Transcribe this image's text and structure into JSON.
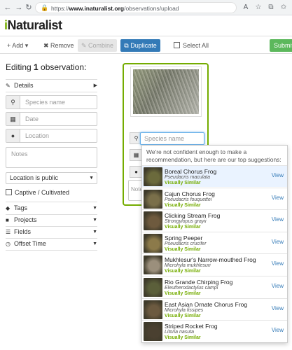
{
  "browser": {
    "url_domain": "www.inaturalist.org",
    "url_path": "/observations/upload",
    "url_prefix": "https://"
  },
  "logo": {
    "first": "i",
    "rest": "Naturalist"
  },
  "toolbar": {
    "add_label": "Add",
    "remove_label": "Remove",
    "combine_label": "Combine",
    "duplicate_label": "Duplicate",
    "select_all_label": "Select All",
    "submit_label": "Submit"
  },
  "panel": {
    "heading_prefix": "Editing ",
    "heading_count": "1",
    "heading_suffix": " observation:",
    "details_label": "Details",
    "species_placeholder": "Species name",
    "date_placeholder": "Date",
    "location_placeholder": "Location",
    "notes_placeholder": "Notes",
    "location_visibility": "Location is public",
    "captive_label": "Captive / Cultivated",
    "sections": [
      "Tags",
      "Projects",
      "Fields",
      "Offset Time"
    ]
  },
  "card": {
    "species_placeholder": "Species name",
    "notes_placeholder": "Note"
  },
  "suggestions": {
    "message": "We're not confident enough to make a recommendation, but here are our top suggestions:",
    "view_label": "View",
    "visually_similar": "Visually Similar",
    "items": [
      {
        "name": "Boreal Chorus Frog",
        "scientific": "Pseudacris maculata",
        "color": "#6b6a3c"
      },
      {
        "name": "Cajun Chorus Frog",
        "scientific": "Pseudacris fouquettei",
        "color": "#7a6f4a"
      },
      {
        "name": "Clicking Stream Frog",
        "scientific": "Strongylopus grayii",
        "color": "#6e5a3e"
      },
      {
        "name": "Spring Peeper",
        "scientific": "Pseudacris crucifer",
        "color": "#8c7a4a"
      },
      {
        "name": "Mukhlesur's Narrow-mouthed Frog",
        "scientific": "Microhyla mukhlesuri",
        "color": "#9b8f7c"
      },
      {
        "name": "Rio Grande Chirping Frog",
        "scientific": "Eleutherodactylus campi",
        "color": "#5b5f3a"
      },
      {
        "name": "East Asian Ornate Chorus Frog",
        "scientific": "Microhyla fissipes",
        "color": "#6c5a40"
      },
      {
        "name": "Striped Rocket Frog",
        "scientific": "Litoria nasuta",
        "color": "#4a4030"
      }
    ]
  }
}
